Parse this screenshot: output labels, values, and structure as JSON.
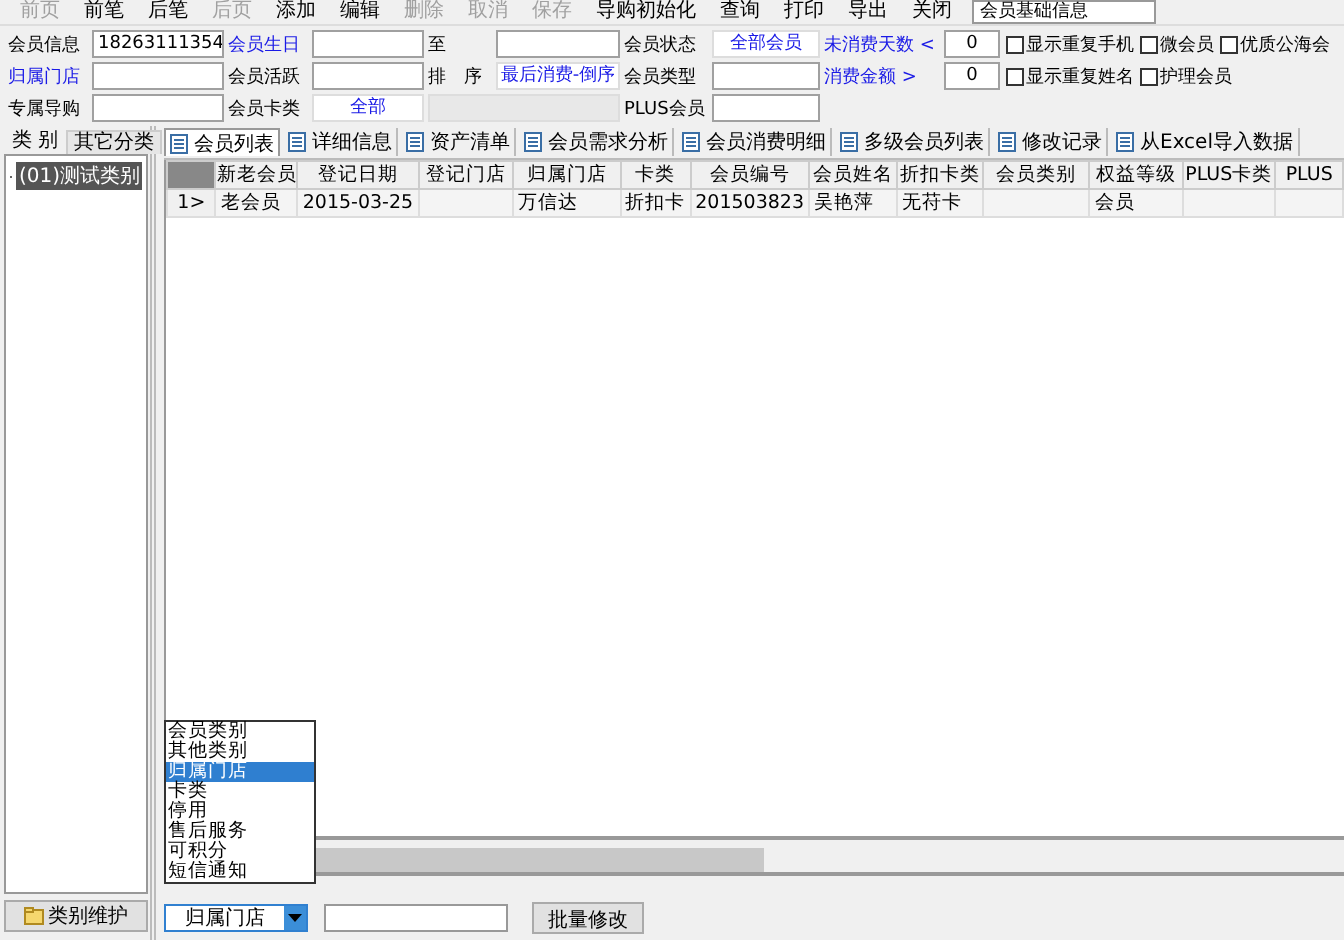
{
  "toolbar": {
    "items": [
      {
        "label": "前页",
        "disabled": true
      },
      {
        "label": "前笔",
        "disabled": false
      },
      {
        "label": "后笔",
        "disabled": false
      },
      {
        "label": "后页",
        "disabled": true
      },
      {
        "label": "添加",
        "disabled": false
      },
      {
        "label": "编辑",
        "disabled": false
      },
      {
        "label": "删除",
        "disabled": true
      },
      {
        "label": "取消",
        "disabled": true
      },
      {
        "label": "保存",
        "disabled": true
      },
      {
        "label": "导购初始化",
        "disabled": false
      },
      {
        "label": "查询",
        "disabled": false
      },
      {
        "label": "打印",
        "disabled": false
      },
      {
        "label": "导出",
        "disabled": false
      },
      {
        "label": "关闭",
        "disabled": false
      }
    ],
    "view_field": {
      "value": "会员基础信息"
    }
  },
  "filters": [
    {
      "items": [
        {
          "label": "会员信息",
          "link": false,
          "field": {
            "kind": "text",
            "value": "18263111354",
            "disabled": false
          }
        },
        {
          "label": "会员生日",
          "link": true,
          "field": {
            "kind": "text",
            "disabled": false
          }
        },
        {
          "label": "至",
          "link": false,
          "field": {
            "kind": "text",
            "disabled": false
          }
        },
        {
          "label": "会员状态",
          "link": false,
          "field": {
            "kind": "select",
            "value": "全部会员",
            "disabled": false
          }
        },
        {
          "label": "未消费天数 <",
          "link": true,
          "field": {
            "kind": "number",
            "value": "0",
            "disabled": false
          }
        }
      ],
      "checks": [
        {
          "label": "显示重复手机",
          "checked": false
        },
        {
          "label": "微会员",
          "checked": false
        },
        {
          "label": "优质公海会",
          "checked": false
        }
      ]
    },
    {
      "items": [
        {
          "label": "归属门店",
          "link": true,
          "field": {
            "kind": "text",
            "disabled": false
          }
        },
        {
          "label": "会员活跃",
          "link": false,
          "field": {
            "kind": "text",
            "disabled": false
          }
        },
        {
          "label": "排　序",
          "link": false,
          "field": {
            "kind": "select",
            "value": "最后消费-倒序",
            "disabled": false
          }
        },
        {
          "label": "会员类型",
          "link": false,
          "field": {
            "kind": "text",
            "disabled": false
          }
        },
        {
          "label": "消费金额 >",
          "link": true,
          "field": {
            "kind": "number",
            "value": "0",
            "disabled": false
          }
        }
      ],
      "checks": [
        {
          "label": "显示重复姓名",
          "checked": false
        },
        {
          "label": "护理会员",
          "checked": false
        }
      ]
    },
    {
      "items": [
        {
          "label": "专属导购",
          "link": false,
          "field": {
            "kind": "text",
            "disabled": false
          }
        },
        {
          "label": "会员卡类",
          "link": false,
          "field": {
            "kind": "select",
            "value": "全部",
            "disabled": false
          }
        },
        {
          "field": {
            "kind": "text",
            "disabled": true
          }
        },
        {
          "label": "PLUS会员",
          "link": false,
          "field": {
            "kind": "text",
            "disabled": false
          }
        }
      ]
    }
  ],
  "category_panel": {
    "tabs": [
      {
        "label": "类 别",
        "selected": true
      },
      {
        "label": "其它分类",
        "selected": false
      }
    ],
    "tree": [
      {
        "label": "(01)测试类别",
        "selected": true
      }
    ],
    "button": "类别维护"
  },
  "member_panel": {
    "tabs": [
      {
        "label": "会员列表",
        "selected": true
      },
      {
        "label": "详细信息",
        "selected": false
      },
      {
        "label": "资产清单",
        "selected": false
      },
      {
        "label": "会员需求分析",
        "selected": false
      },
      {
        "label": "会员消费明细",
        "selected": false
      },
      {
        "label": "多级会员列表",
        "selected": false
      },
      {
        "label": "修改记录",
        "selected": false
      },
      {
        "label": "从Excel导入数据",
        "selected": false
      }
    ],
    "table": {
      "columns": [
        "新老会员",
        "登记日期",
        "登记门店",
        "归属门店",
        "卡类",
        "会员编号",
        "会员姓名",
        "折扣卡类",
        "会员类别",
        "权益等级",
        "PLUS卡类",
        "PLUS"
      ],
      "rows": [
        {
          "indicator": "1>",
          "cells": [
            "老会员",
            "2015-03-25",
            "",
            "万信达",
            "折扣卡",
            "201503823",
            "吴艳萍",
            "无苻卡",
            "",
            "会员",
            "",
            ""
          ]
        }
      ]
    },
    "batch": {
      "combo": {
        "value": "归属门店",
        "expanded": true,
        "options": [
          {
            "label": "会员类别",
            "selected": false
          },
          {
            "label": "其他类别",
            "selected": false
          },
          {
            "label": "归属门店",
            "selected": true
          },
          {
            "label": "卡类",
            "selected": false
          },
          {
            "label": "停用",
            "selected": false
          },
          {
            "label": "售后服务",
            "selected": false
          },
          {
            "label": "可积分",
            "selected": false
          },
          {
            "label": "短信通知",
            "selected": false
          }
        ]
      },
      "button": "批量修改"
    }
  }
}
